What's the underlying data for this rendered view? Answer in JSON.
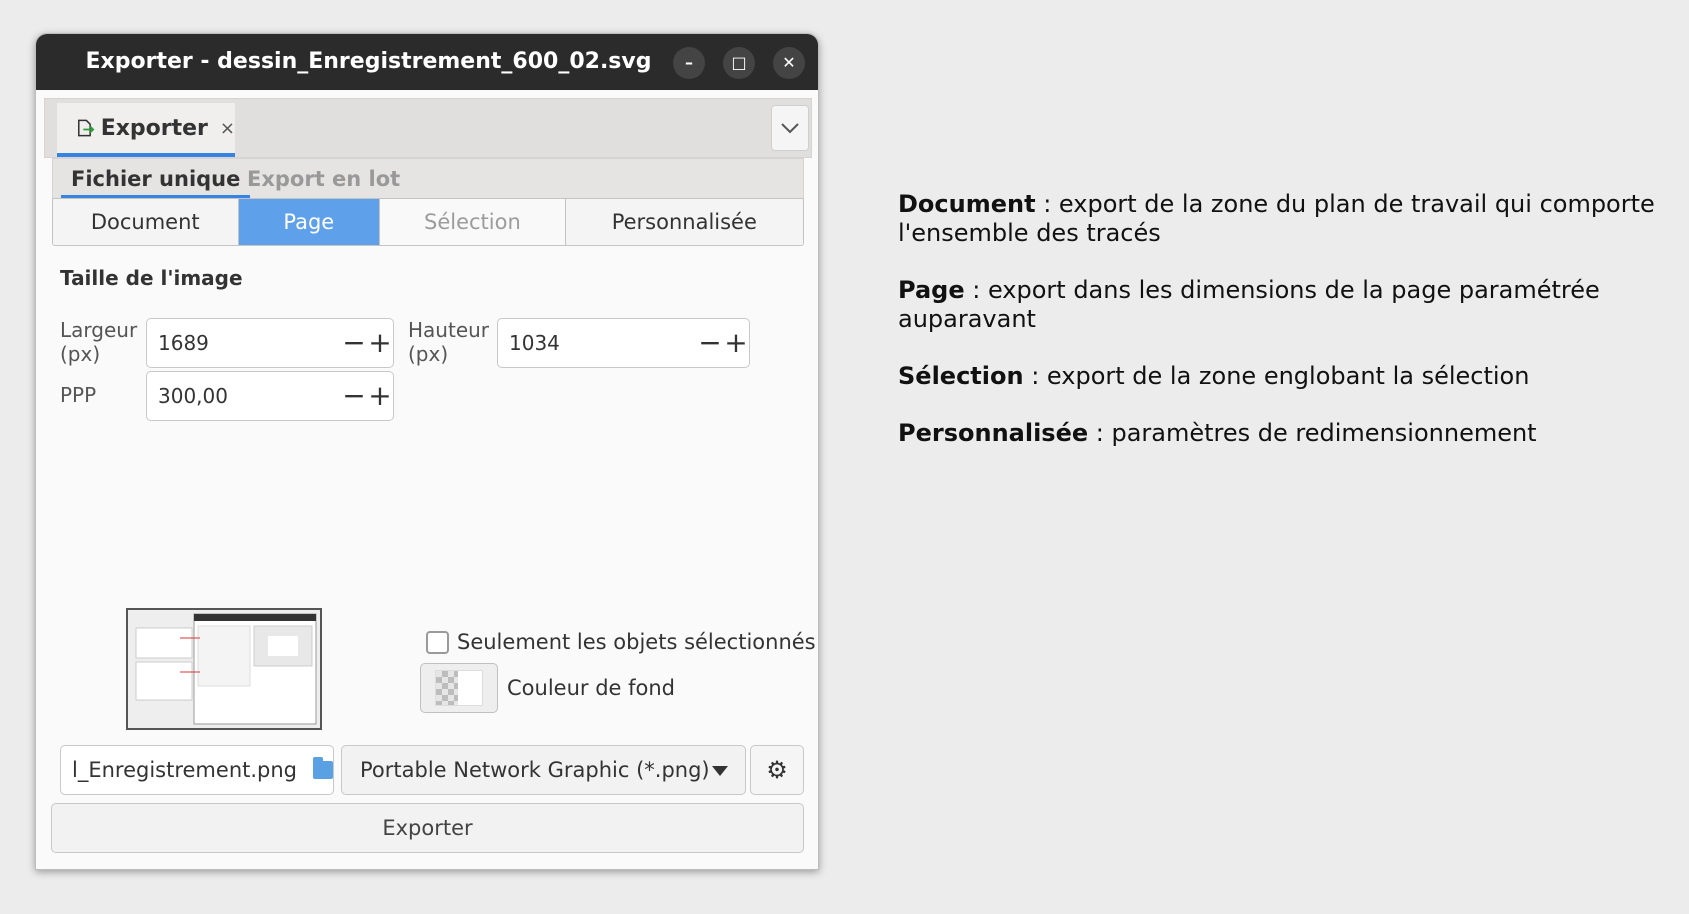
{
  "window": {
    "title": "Exporter - dessin_Enregistrement_600_02.svg",
    "controls": {
      "minimize": "–",
      "maximize": "□",
      "close": "✕"
    }
  },
  "dock": {
    "tab_label": "Exporter",
    "tab_close": "×",
    "menu_icon": "chevron-down-icon"
  },
  "subtabs": {
    "single": "Fichier unique",
    "batch": "Export en lot"
  },
  "areas": {
    "document": "Document",
    "page": "Page",
    "selection": "Sélection",
    "custom": "Personnalisée",
    "active": "Page"
  },
  "image_size": {
    "title": "Taille de l'image",
    "width_label_1": "Largeur",
    "width_label_2": "(px)",
    "width_value": "1689",
    "height_label_1": "Hauteur",
    "height_label_2": "(px)",
    "height_value": "1034",
    "dpi_label": "PPP",
    "dpi_value": "300,00",
    "minus": "−",
    "plus": "+"
  },
  "options": {
    "only_selected": "Seulement les objets sélectionnés",
    "only_selected_checked": false,
    "background_color": "Couleur de fond"
  },
  "file": {
    "filename": "l_Enregistrement.png",
    "format": "Portable Network Graphic (*.png)",
    "export_button": "Exporter"
  },
  "notes": [
    {
      "term": "Document",
      "text": " : export de la zone du plan de travail qui comporte l'ensemble des tracés"
    },
    {
      "term": "Page",
      "text": " : export dans les dimensions de la page paramétrée auparavant"
    },
    {
      "term": "Sélection",
      "text": " : export de la zone englobant la sélection"
    },
    {
      "term": "Personnalisée",
      "text": " : paramètres de redimensionnement"
    }
  ],
  "colors": {
    "accent": "#3584e4",
    "active_button": "#5fa0ea",
    "titlebar": "#2b2b2b"
  }
}
